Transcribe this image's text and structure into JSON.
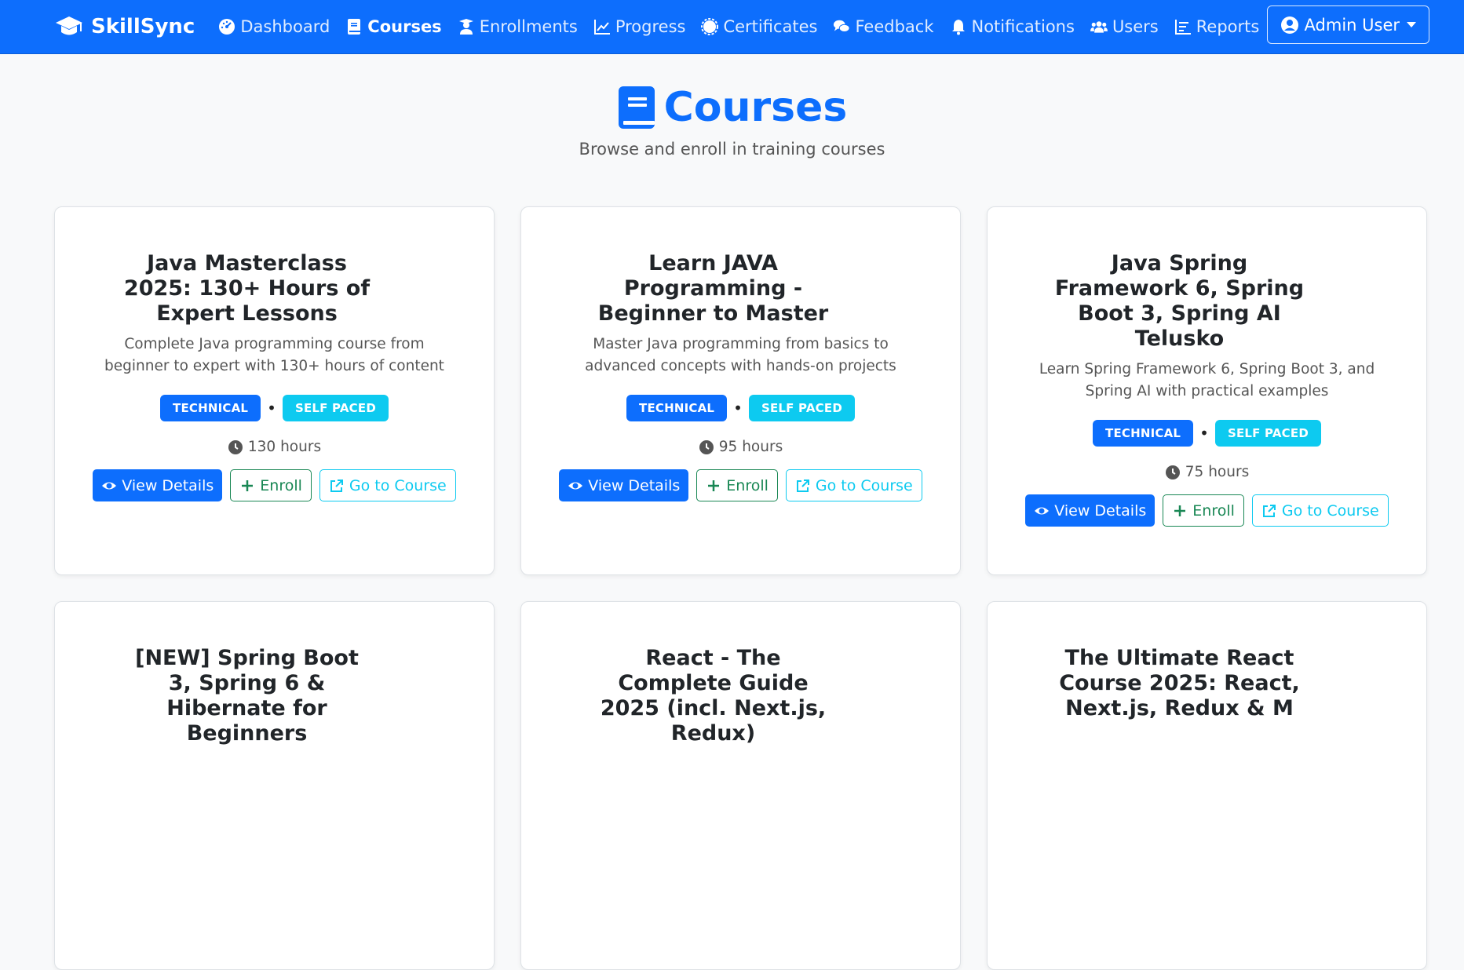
{
  "nav": {
    "brand": "SkillSync",
    "items": [
      {
        "label": "Dashboard",
        "icon": "dashboard-icon",
        "active": false
      },
      {
        "label": "Courses",
        "icon": "book-icon",
        "active": true
      },
      {
        "label": "Enrollments",
        "icon": "user-graduate-icon",
        "active": false
      },
      {
        "label": "Progress",
        "icon": "chart-line-icon",
        "active": false
      },
      {
        "label": "Certificates",
        "icon": "certificate-icon",
        "active": false
      },
      {
        "label": "Feedback",
        "icon": "comments-icon",
        "active": false
      },
      {
        "label": "Notifications",
        "icon": "bell-icon",
        "active": false
      },
      {
        "label": "Users",
        "icon": "users-icon",
        "active": false
      },
      {
        "label": "Reports",
        "icon": "reports-icon",
        "active": false
      }
    ],
    "user": "Admin User"
  },
  "header": {
    "title": "Courses",
    "subtitle": "Browse and enroll in training courses"
  },
  "courses": [
    {
      "title": "Java Masterclass 2025: 130+ Hours of Expert Lessons",
      "description": "Complete Java programming course from beginner to expert with 130+ hours of content",
      "category": "TECHNICAL",
      "pace": "SELF PACED",
      "hours": "130 hours"
    },
    {
      "title": "Learn JAVA Programming - Beginner to Master",
      "description": "Master Java programming from basics to advanced concepts with hands-on projects",
      "category": "TECHNICAL",
      "pace": "SELF PACED",
      "hours": "95 hours"
    },
    {
      "title": "Java Spring Framework 6, Spring Boot 3, Spring AI Telusko",
      "description": "Learn Spring Framework 6, Spring Boot 3, and Spring AI with practical examples",
      "category": "TECHNICAL",
      "pace": "SELF PACED",
      "hours": "75 hours"
    },
    {
      "title": "[NEW] Spring Boot 3, Spring 6 & Hibernate for Beginners",
      "description": "",
      "category": "",
      "pace": "",
      "hours": ""
    },
    {
      "title": "React - The Complete Guide 2025 (incl. Next.js, Redux)",
      "description": "",
      "category": "",
      "pace": "",
      "hours": ""
    },
    {
      "title": "The Ultimate React Course 2025: React, Next.js, Redux & M",
      "description": "",
      "category": "",
      "pace": "",
      "hours": ""
    }
  ],
  "buttons": {
    "view": "View Details",
    "enroll": "Enroll",
    "go": "Go to Course"
  },
  "colors": {
    "primary": "#0d6efd",
    "info": "#0dcaf0",
    "success": "#198754"
  }
}
